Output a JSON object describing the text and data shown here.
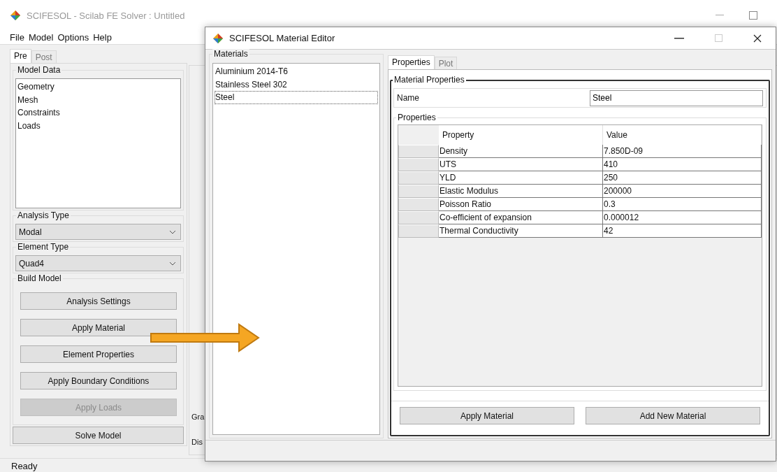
{
  "main_window": {
    "title": "SCIFESOL - Scilab FE Solver : Untitled",
    "menu": [
      "File",
      "Model",
      "Options",
      "Help"
    ],
    "tabs": [
      {
        "label": "Pre",
        "selected": true
      },
      {
        "label": "Post",
        "selected": false
      }
    ],
    "model_data": {
      "title": "Model Data",
      "items": [
        "Geometry",
        "Mesh",
        "Constraints",
        "Loads"
      ]
    },
    "analysis_type": {
      "title": "Analysis Type",
      "value": "Modal"
    },
    "element_type": {
      "title": "Element Type",
      "value": "Quad4"
    },
    "build_model": {
      "title": "Build Model",
      "buttons": [
        {
          "label": "Analysis Settings",
          "disabled": false
        },
        {
          "label": "Apply Material",
          "disabled": false
        },
        {
          "label": "Element Properties",
          "disabled": false
        },
        {
          "label": "Apply Boundary Conditions",
          "disabled": false
        },
        {
          "label": "Apply Loads",
          "disabled": true
        }
      ]
    },
    "solve_button": "Solve Model",
    "side_tabs": [
      "Gra",
      "Dis"
    ],
    "status_bar": "Ready"
  },
  "dialog": {
    "title": "SCIFESOL Material Editor",
    "materials": {
      "title": "Materials",
      "items": [
        {
          "label": "Aluminium 2014-T6",
          "selected": false
        },
        {
          "label": "Stainless Steel 302",
          "selected": false
        },
        {
          "label": "Steel",
          "selected": true
        }
      ]
    },
    "tabs": [
      {
        "label": "Properties",
        "selected": true
      },
      {
        "label": "Plot",
        "selected": false
      }
    ],
    "material_properties": {
      "title": "Material Properties",
      "name_label": "Name",
      "name_value": "Steel"
    },
    "properties": {
      "title": "Properties",
      "columns": [
        "Property",
        "Value"
      ],
      "rows": [
        {
          "property": "Density",
          "value": "7.850D-09"
        },
        {
          "property": "UTS",
          "value": "410"
        },
        {
          "property": "YLD",
          "value": "250"
        },
        {
          "property": "Elastic Modulus",
          "value": "200000"
        },
        {
          "property": "Poisson Ratio",
          "value": "0.3"
        },
        {
          "property": "Co-efficient of expansion",
          "value": "0.000012"
        },
        {
          "property": "Thermal Conductivity",
          "value": "42"
        }
      ]
    },
    "buttons": [
      "Apply Material",
      "Add New Material"
    ]
  }
}
